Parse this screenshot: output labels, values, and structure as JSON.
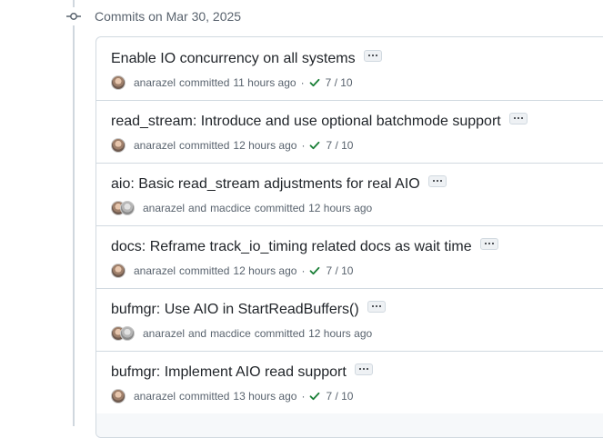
{
  "header": {
    "date_text": "Commits on Mar 30, 2025"
  },
  "commits": [
    {
      "title": "Enable IO concurrency on all systems",
      "author": "anarazel",
      "co_author": "",
      "committed": "committed",
      "time": "11 hours ago",
      "status": "7 / 10"
    },
    {
      "title": "read_stream: Introduce and use optional batchmode support",
      "author": "anarazel",
      "co_author": "",
      "committed": "committed",
      "time": "12 hours ago",
      "status": "7 / 10"
    },
    {
      "title": "aio: Basic read_stream adjustments for real AIO",
      "author": "anarazel",
      "and": "and",
      "co_author": "macdice",
      "committed": "committed",
      "time": "12 hours ago",
      "status": ""
    },
    {
      "title": "docs: Reframe track_io_timing related docs as wait time",
      "author": "anarazel",
      "co_author": "",
      "committed": "committed",
      "time": "12 hours ago",
      "status": "7 / 10"
    },
    {
      "title": "bufmgr: Use AIO in StartReadBuffers()",
      "author": "anarazel",
      "and": "and",
      "co_author": "macdice",
      "committed": "committed",
      "time": "12 hours ago",
      "status": ""
    },
    {
      "title": "bufmgr: Implement AIO read support",
      "author": "anarazel",
      "co_author": "",
      "committed": "committed",
      "time": "13 hours ago",
      "status": "7 / 10"
    }
  ],
  "icons": {
    "timeline": "git-commit-icon",
    "status": "check-icon",
    "more": "ellipsis-icon"
  },
  "colors": {
    "check": "#1a7f37",
    "muted": "#59636e",
    "border": "#d1d9e0"
  }
}
